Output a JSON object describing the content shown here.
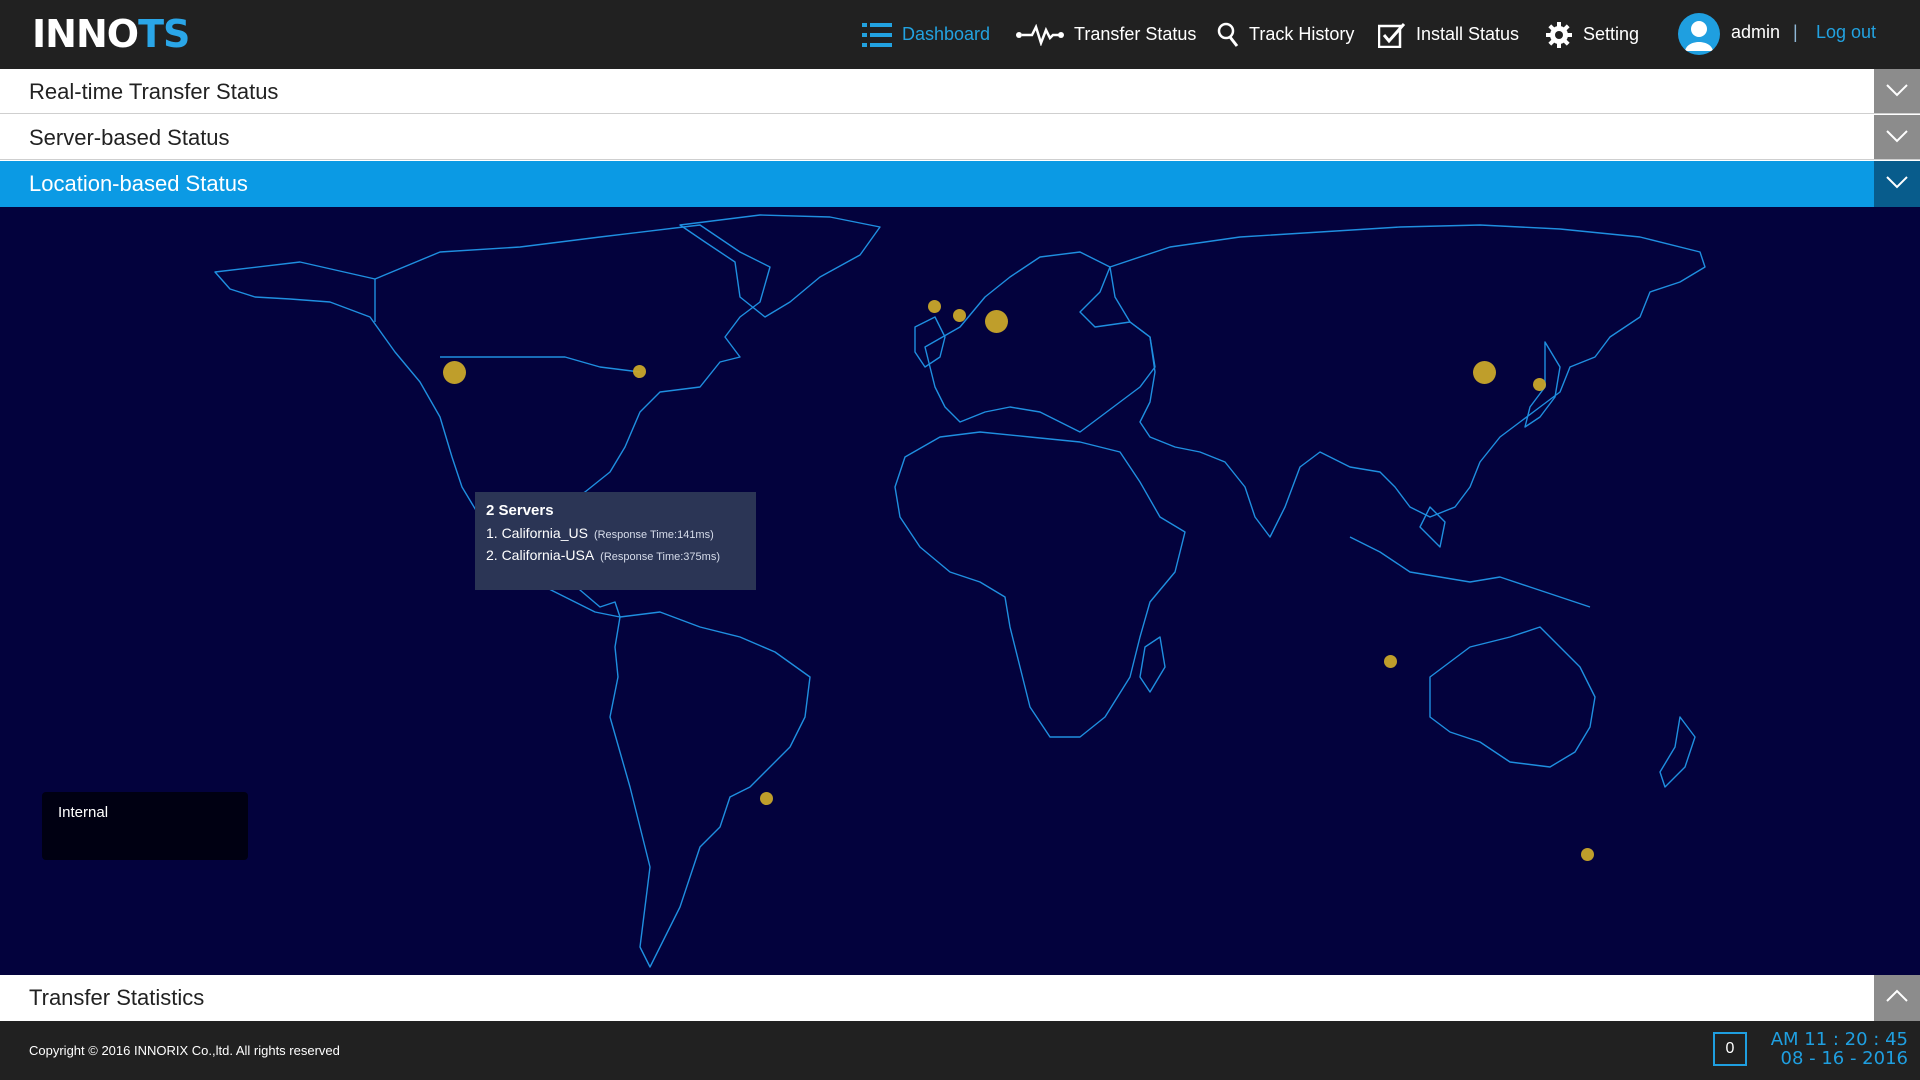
{
  "brand": {
    "logo_main": "INNO",
    "logo_accent": "TS",
    "accent_color": "#2aa6e8"
  },
  "nav": {
    "items": [
      {
        "label": "Dashboard",
        "icon": "list-icon",
        "active": true
      },
      {
        "label": "Transfer Status",
        "icon": "pulse-icon",
        "active": false
      },
      {
        "label": "Track History",
        "icon": "search-icon",
        "active": false
      },
      {
        "label": "Install Status",
        "icon": "checkbox-icon",
        "active": false
      },
      {
        "label": "Setting",
        "icon": "gear-icon",
        "active": false
      }
    ],
    "user": "admin",
    "separator": "|",
    "logout": "Log out"
  },
  "sections": {
    "realtime": "Real-time Transfer Status",
    "server": "Server-based Status",
    "location": "Location-based Status",
    "statistics": "Transfer Statistics"
  },
  "map": {
    "background_color": "#03023d",
    "land_stroke": "#1f8fe0",
    "marker_color": "#c9a62a",
    "tooltip": {
      "title": "2 Servers",
      "items": [
        {
          "name": "1. California_US",
          "detail": "(Response Time:141ms)"
        },
        {
          "name": "2. California-USA",
          "detail": "(Response Time:375ms)"
        }
      ]
    },
    "legend": {
      "label": "Internal"
    }
  },
  "footer": {
    "copyright": "Copyright © 2016 INNORIX Co.,ltd. All rights reserved",
    "counter": "0",
    "time": "AM 11 : 20 : 45",
    "date": "08 - 16 - 2016"
  }
}
